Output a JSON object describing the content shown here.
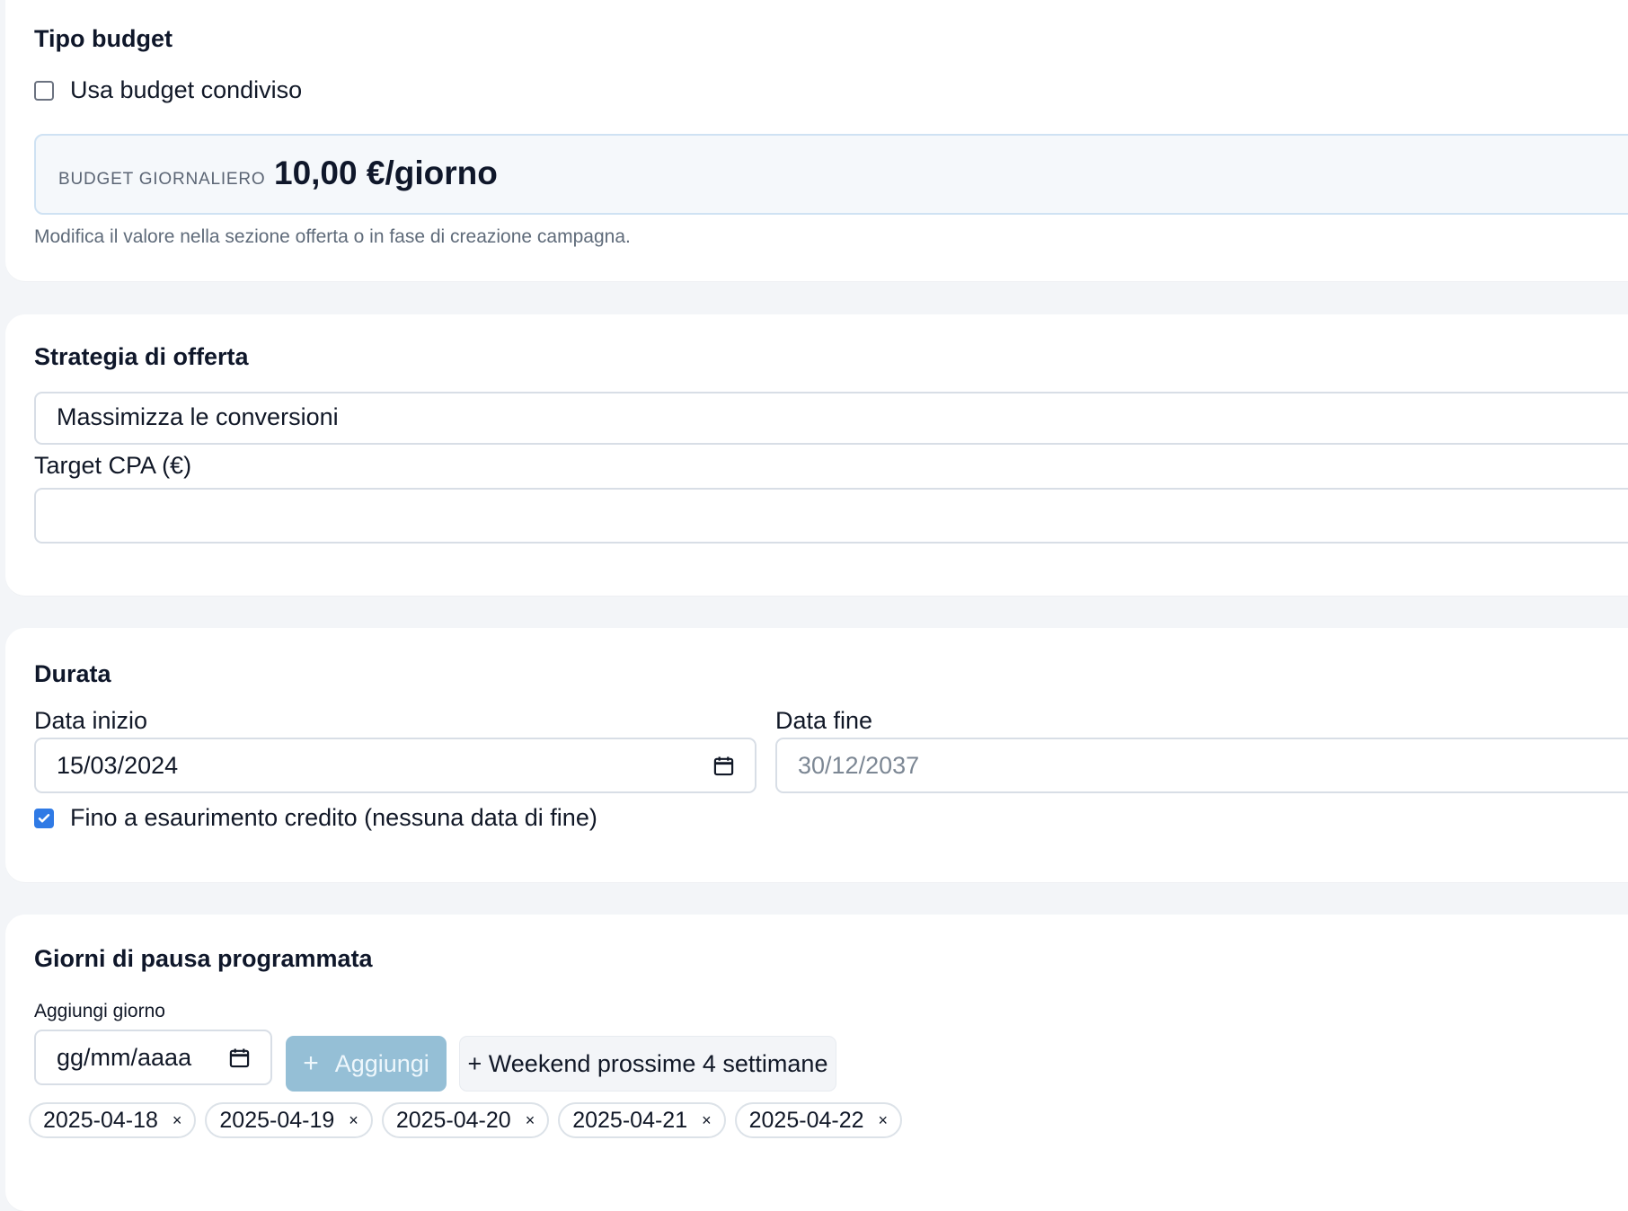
{
  "budget": {
    "title": "Tipo budget",
    "shared_label": "Usa budget condiviso",
    "daily_label": "BUDGET GIORNALIERO",
    "daily_value": "10,00 €/giorno",
    "helper": "Modifica il valore nella sezione offerta o in fase di creazione campagna."
  },
  "strategy": {
    "title": "Strategia di offerta",
    "selected": "Massimizza le conversioni",
    "target_label": "Target CPA (€)",
    "target_value": ""
  },
  "duration": {
    "title": "Durata",
    "start_label": "Data inizio",
    "start_value": "15/03/2024",
    "end_label": "Data fine",
    "end_value": "30/12/2037",
    "until_credit_label": "Fino a esaurimento credito (nessuna data di fine)"
  },
  "pause_days": {
    "title": "Giorni di pausa programmata",
    "add_day_label": "Aggiungi giorno",
    "date_placeholder": "gg/mm/aaaa",
    "add_button": "Aggiungi",
    "weekend_button": "+ Weekend prossime 4 settimane",
    "chips": [
      "2025-04-18",
      "2025-04-19",
      "2025-04-20",
      "2025-04-21",
      "2025-04-22"
    ]
  },
  "colors": {
    "accent": "#2f7ae5",
    "button_disabled": "#95bfd6"
  },
  "icons": {
    "calendar": "calendar-icon",
    "check": "check-icon",
    "plus": "plus-icon",
    "remove": "close-icon"
  }
}
